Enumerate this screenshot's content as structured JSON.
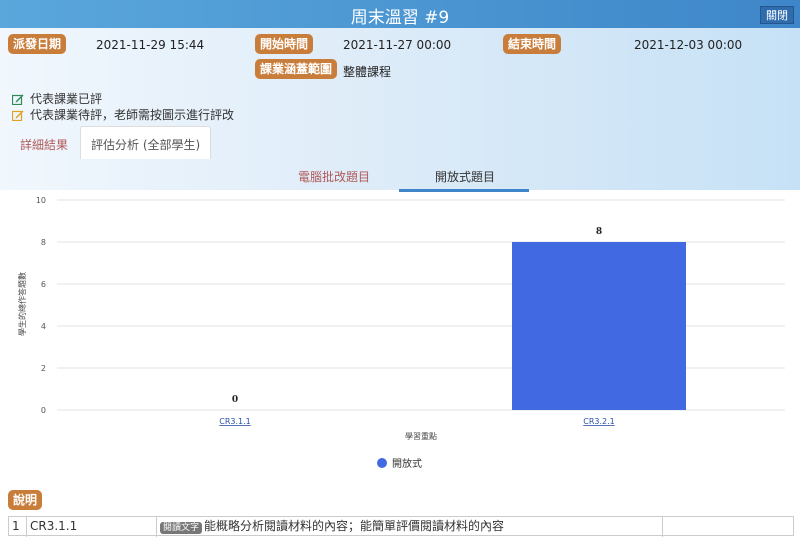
{
  "window": {
    "title": "周末溫習 #9",
    "close_label": "關閉"
  },
  "info": {
    "assign_label": "派發日期",
    "assign_value": "2021-11-29 15:44",
    "start_label": "開始時間",
    "start_value": "2021-11-27 00:00",
    "end_label": "結束時間",
    "end_value": "2021-12-03 00:00",
    "scope_label": "課業涵蓋範圍",
    "scope_value": "整體課程"
  },
  "legend_notes": {
    "graded": "代表課業已評",
    "pending": "代表課業待評，老師需按圖示進行評改"
  },
  "tabs": {
    "details": "詳細結果",
    "analysis": "評估分析 (全部學生)"
  },
  "subtabs": {
    "auto": "電腦批改題目",
    "open": "開放式題目"
  },
  "chart_data": {
    "type": "bar",
    "categories": [
      "CR3.1.1",
      "CR3.2.1"
    ],
    "series": [
      {
        "name": "開放式",
        "values": [
          0,
          8
        ],
        "color": "#4169e1"
      }
    ],
    "ylabel": "學生的總作答題數",
    "xlabel": "學習重點",
    "ylim": [
      0,
      10
    ],
    "yticks": [
      "0",
      "2",
      "4",
      "6",
      "8",
      "10"
    ],
    "data_labels": [
      "0",
      "8"
    ],
    "legend": "bottom-center",
    "grid": true
  },
  "description": {
    "label": "說明",
    "rows": [
      {
        "index": "1",
        "code": "CR3.1.1",
        "tag": "閱讀文字",
        "text": "能概略分析閱讀材料的內容；能簡單評價閱讀材料的內容"
      }
    ]
  }
}
